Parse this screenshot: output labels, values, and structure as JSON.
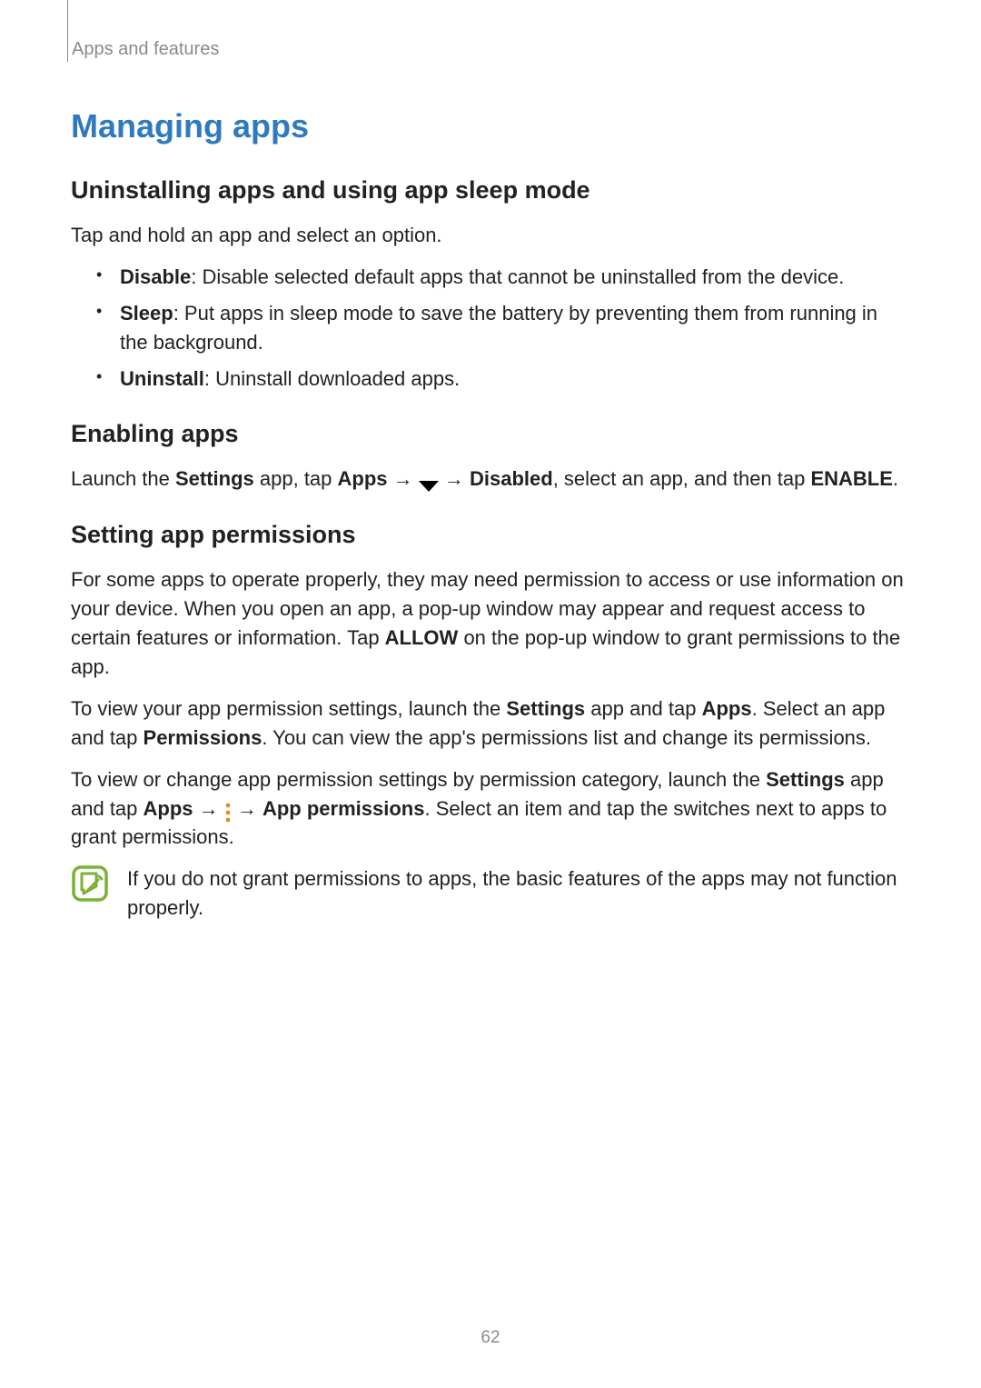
{
  "running_header": "Apps and features",
  "section_title": "Managing apps",
  "sub1": {
    "title": "Uninstalling apps and using app sleep mode",
    "intro": "Tap and hold an app and select an option.",
    "bullets": [
      {
        "label": "Disable",
        "text": ": Disable selected default apps that cannot be uninstalled from the device."
      },
      {
        "label": "Sleep",
        "text": ": Put apps in sleep mode to save the battery by preventing them from running in the background."
      },
      {
        "label": "Uninstall",
        "text": ": Uninstall downloaded apps."
      }
    ]
  },
  "sub2": {
    "title": "Enabling apps",
    "para": {
      "p1": "Launch the ",
      "p2": "Settings",
      "p3": " app, tap ",
      "p4": "Apps",
      "p5": " → ",
      "p6": " → ",
      "p7": "Disabled",
      "p8": ", select an app, and then tap ",
      "p9": "ENABLE",
      "p10": "."
    }
  },
  "sub3": {
    "title": "Setting app permissions",
    "para1": {
      "a": "For some apps to operate properly, they may need permission to access or use information on your device. When you open an app, a pop-up window may appear and request access to certain features or information. Tap ",
      "b": "ALLOW",
      "c": " on the pop-up window to grant permissions to the app."
    },
    "para2": {
      "a": "To view your app permission settings, launch the ",
      "b": "Settings",
      "c": " app and tap ",
      "d": "Apps",
      "e": ". Select an app and tap ",
      "f": "Permissions",
      "g": ". You can view the app's permissions list and change its permissions."
    },
    "para3": {
      "a": "To view or change app permission settings by permission category, launch the ",
      "b": "Settings",
      "c": " app and tap ",
      "d": "Apps",
      "e": " → ",
      "f": " → ",
      "g": "App permissions",
      "h": ". Select an item and tap the switches next to apps to grant permissions."
    },
    "note": "If you do not grant permissions to apps, the basic features of the apps may not function properly."
  },
  "page_number": "62"
}
